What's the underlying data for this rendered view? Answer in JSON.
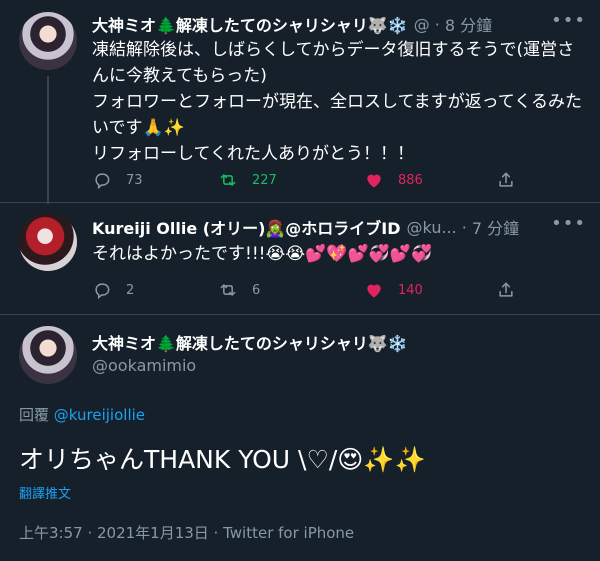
{
  "tweet1": {
    "name": "大神ミオ🌲解凍したてのシャリシャリ🐺❄️",
    "handle": "@",
    "time": "8 分鐘",
    "text": "凍結解除後は、しばらくしてからデータ復旧するそうで(運営さんに今教えてもらった)\nフォロワーとフォローが現在、全ロスしてますが返ってくるみたいです🙏✨\nリフォローしてくれた人ありがとう！！！",
    "replies": "73",
    "retweets": "227",
    "likes": "886"
  },
  "tweet2": {
    "name": "Kureiji Ollie (オリー)🧟‍♀️@ホロライブID",
    "handle": "@ku...",
    "time": "7 分鐘",
    "text": "それはよかったです!!!😭😭💕💖💕💞💕💞",
    "replies": "2",
    "retweets": "6",
    "likes": "140"
  },
  "tweet3": {
    "name": "大神ミオ🌲解凍したてのシャリシャリ🐺❄️",
    "handle": "@ookamimio",
    "reply_prefix": "回覆",
    "reply_mention": "@kureijiollie",
    "text": "オリちゃんTHANK YOU \\♡/😍✨✨",
    "translate": "翻譯推文",
    "timestamp": "上午3:57 · 2021年1月13日 · Twitter for iPhone"
  },
  "colors": {
    "background": "#15202b",
    "muted": "#8899a6",
    "accent": "#1da1f2",
    "retweet": "#17bf63",
    "like": "#e0245e",
    "divider": "#38444d"
  },
  "icons": [
    "reply-icon",
    "retweet-icon",
    "like-icon",
    "share-icon",
    "more-icon"
  ]
}
